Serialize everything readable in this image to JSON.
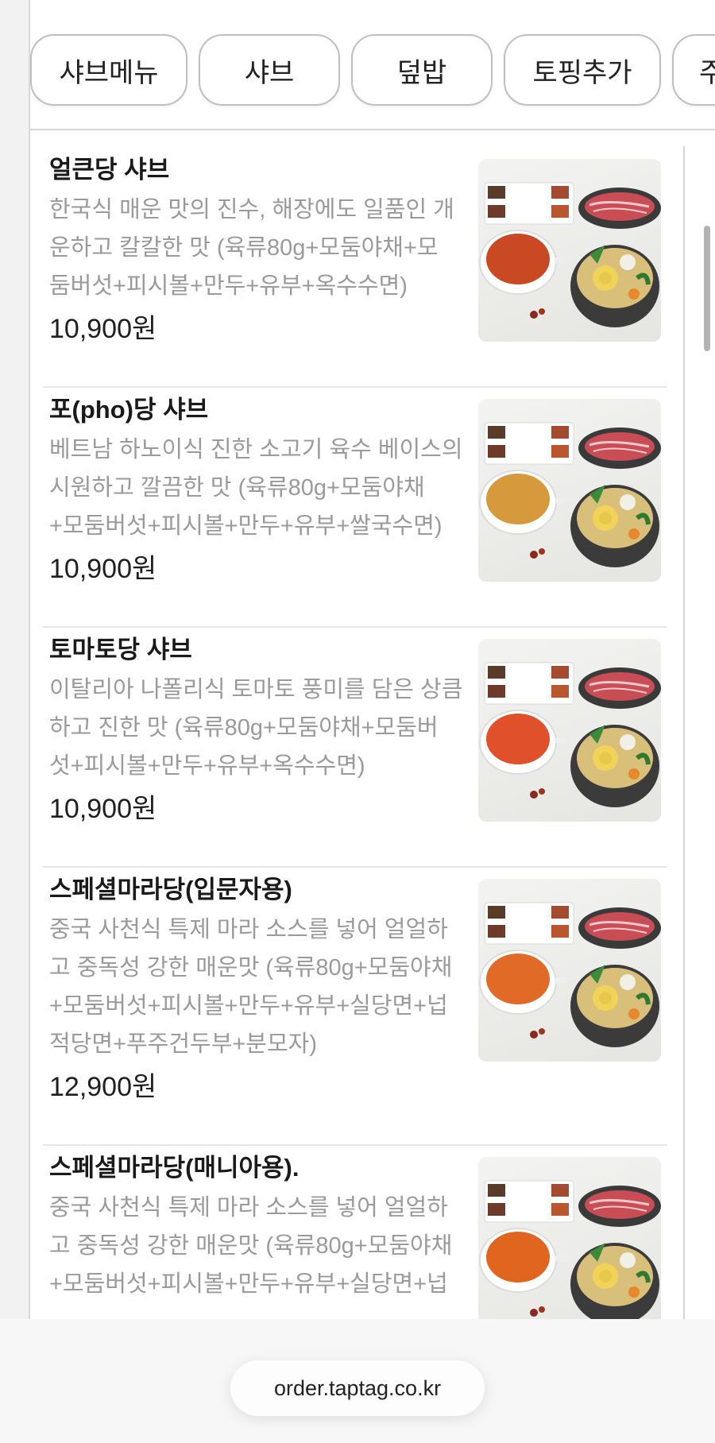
{
  "tabs": [
    "샤브메뉴",
    "샤브",
    "덮밥",
    "토핑추가",
    "주"
  ],
  "menu_items": [
    {
      "name": "얼큰당 샤브",
      "desc_lines": [
        "한국식 매운 맛의 진수, 해장에도 일품인 개",
        "운하고 칼칼한 맛 (육류80g+모둠야채+모",
        "둠버섯+피시볼+만두+유부+옥수수면)"
      ],
      "price": "10,900원",
      "soup_color": "#c94a22"
    },
    {
      "name": "포(pho)당 샤브",
      "desc_lines": [
        "베트남 하노이식 진한 소고기 육수 베이스의",
        "시원하고 깔끔한 맛 (육류80g+모둠야채",
        "+모둠버섯+피시볼+만두+유부+쌀국수면)"
      ],
      "price": "10,900원",
      "soup_color": "#d69a3c"
    },
    {
      "name": "토마토당 샤브",
      "desc_lines": [
        "이탈리아 나폴리식 토마토 풍미를 담은 상큼",
        "하고 진한 맛 (육류80g+모둠야채+모둠버",
        "섯+피시볼+만두+유부+옥수수면)"
      ],
      "price": "10,900원",
      "soup_color": "#e0502a"
    },
    {
      "name": "스페셜마라당(입문자용)",
      "desc_lines": [
        "중국 사천식 특제 마라 소스를 넣어 얼얼하",
        "고 중독성 강한 매운맛 (육류80g+모둠야채",
        "+모둠버섯+피시볼+만두+유부+실당면+넙",
        "적당면+푸주건두부+분모자)"
      ],
      "price": "12,900원",
      "soup_color": "#e06a26"
    },
    {
      "name": "스페셜마라당(매니아용).",
      "desc_lines": [
        "중국 사천식 특제 마라 소스를 넣어 얼얼하",
        "고 중독성 강한 매운맛 (육류80g+모둠야채",
        "+모둠버섯+피시볼+만두+유부+실당면+넙"
      ],
      "price": "",
      "soup_color": "#e0661f"
    }
  ],
  "url": "order.taptag.co.kr"
}
